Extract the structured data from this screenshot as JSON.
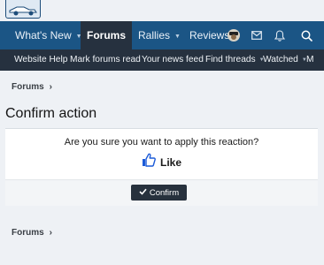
{
  "nav": {
    "items": [
      {
        "label": "What's New",
        "has_menu": true
      },
      {
        "label": "Forums",
        "active": true
      },
      {
        "label": "Rallies",
        "has_menu": true
      },
      {
        "label": "Reviews",
        "has_menu": false
      }
    ],
    "icons": [
      "avatar-icon",
      "mail-icon",
      "bell-icon",
      "search-icon"
    ]
  },
  "subnav": {
    "items": [
      {
        "label": "Website Help"
      },
      {
        "label": "Mark forums read"
      },
      {
        "label": "Your news feed"
      },
      {
        "label": "Find threads",
        "has_menu": true
      },
      {
        "label": "Watched",
        "has_menu": true
      },
      {
        "label": "M"
      }
    ]
  },
  "breadcrumb": {
    "top": "Forums",
    "bottom": "Forums"
  },
  "page": {
    "title": "Confirm action"
  },
  "dialog": {
    "question": "Are you sure you want to apply this reaction?",
    "reaction_label": "Like",
    "confirm_label": "Confirm"
  },
  "colors": {
    "nav_bg": "#1b5585",
    "subnav_bg": "#26313f",
    "like_blue": "#1c5bd8"
  }
}
